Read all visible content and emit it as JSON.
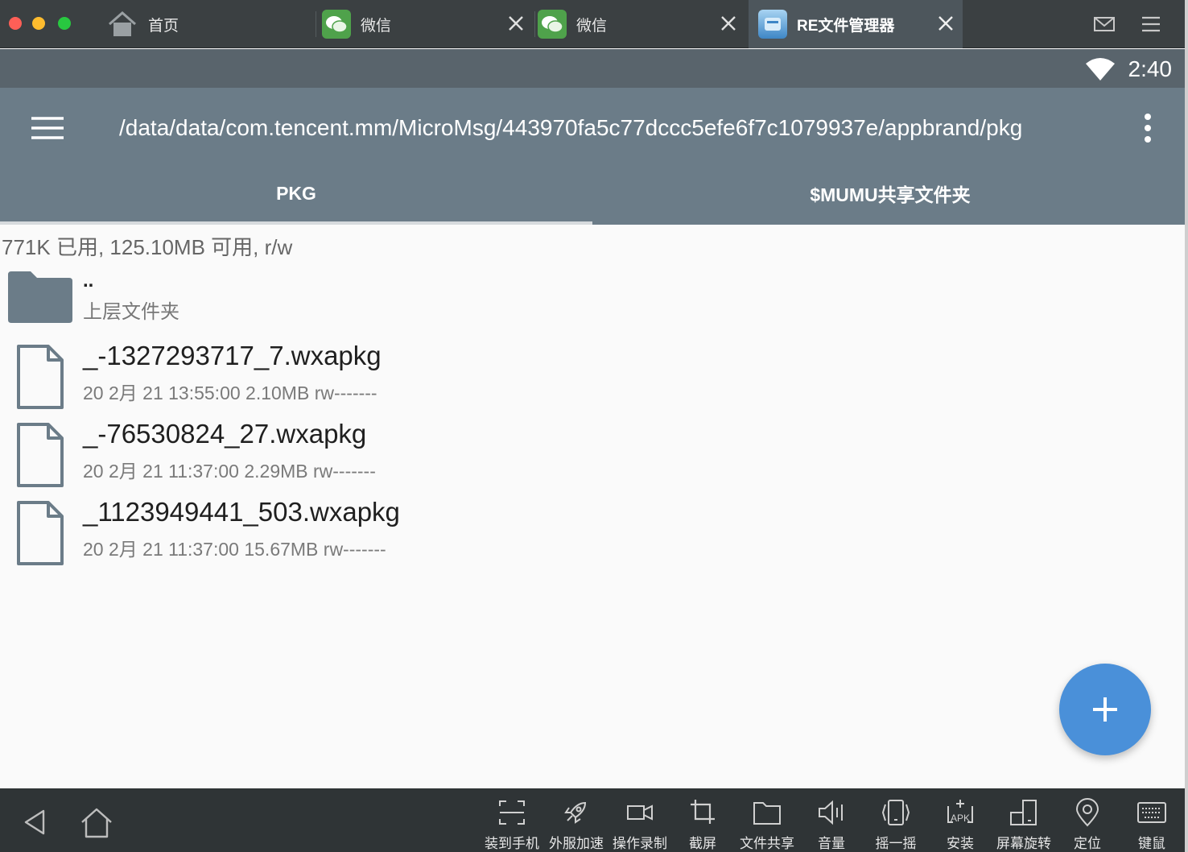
{
  "window_tabs": {
    "home_label": "首页",
    "wechat1_label": "微信",
    "wechat2_label": "微信",
    "re_label": "RE文件管理器"
  },
  "status": {
    "time": "2:40"
  },
  "toolbar": {
    "path": "/data/data/com.tencent.mm/MicroMsg/443970fa5c77dccc5efe6f7c1079937e/appbrand/pkg"
  },
  "tabs": {
    "pkg": "PKG",
    "mumu": "$MUMU共享文件夹",
    "active": "PKG"
  },
  "storage_info": "771K 已用, 125.10MB 可用, r/w",
  "parent": {
    "dots": "..",
    "label": "上层文件夹"
  },
  "files": [
    {
      "name": "_-1327293717_7.wxapkg",
      "meta": "20 2月 21 13:55:00  2.10MB  rw-------"
    },
    {
      "name": "_-76530824_27.wxapkg",
      "meta": "20 2月 21 11:37:00  2.29MB  rw-------"
    },
    {
      "name": "_1123949441_503.wxapkg",
      "meta": "20 2月 21 11:37:00  15.67MB  rw-------"
    }
  ],
  "fab_label": "+",
  "bottom_tools": [
    {
      "label": "装到手机",
      "icon": "scan-icon"
    },
    {
      "label": "外服加速",
      "icon": "rocket-icon"
    },
    {
      "label": "操作录制",
      "icon": "video-icon"
    },
    {
      "label": "截屏",
      "icon": "crop-icon"
    },
    {
      "label": "文件共享",
      "icon": "folder-icon"
    },
    {
      "label": "音量",
      "icon": "volume-icon"
    },
    {
      "label": "摇一摇",
      "icon": "shake-icon"
    },
    {
      "label": "安装",
      "icon": "apk-icon"
    },
    {
      "label": "屏幕旋转",
      "icon": "rotate-icon"
    },
    {
      "label": "定位",
      "icon": "location-icon"
    },
    {
      "label": "键鼠",
      "icon": "keyboard-icon"
    }
  ],
  "bottom_tool_apk_text": "APK",
  "colors": {
    "toolbar": "#6b7c88",
    "statusbar": "#59646c",
    "fab": "#4a90d9",
    "tabbar": "#3b4042"
  }
}
